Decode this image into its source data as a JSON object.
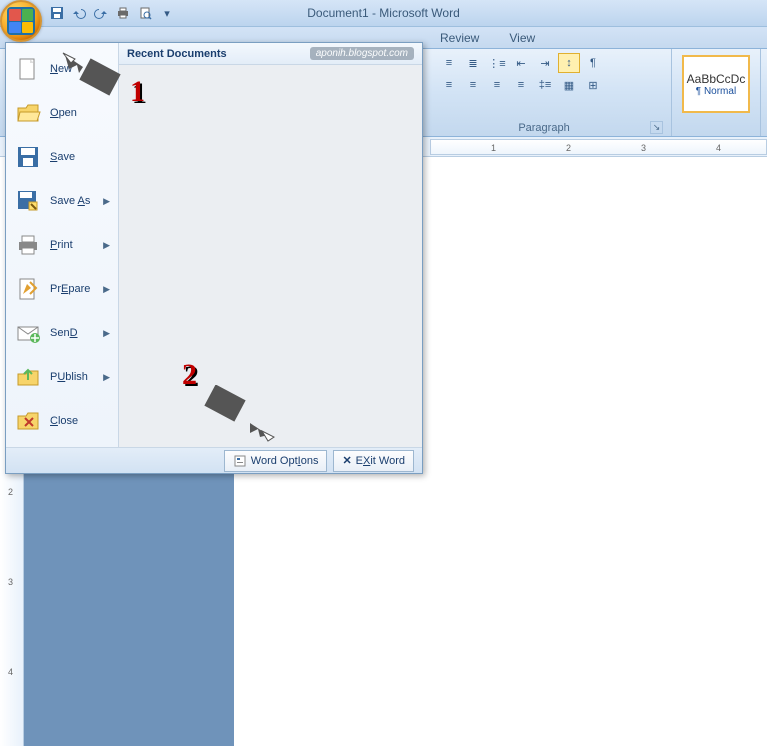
{
  "title": "Document1 - Microsoft Word",
  "qat_icons": [
    "save-icon",
    "undo-icon",
    "redo-icon",
    "quick-print-icon",
    "print-preview-icon",
    "customize-qat-icon"
  ],
  "tabs": {
    "review": "Review",
    "view": "View"
  },
  "ribbon": {
    "paragraph_label": "Paragraph",
    "styles_sample": "AaBbCcDc",
    "styles_name": "¶ Normal"
  },
  "ruler": {
    "nums": [
      "1",
      "2",
      "3",
      "4"
    ]
  },
  "v_ruler": {
    "nums": [
      "2",
      "3",
      "4"
    ]
  },
  "menu": {
    "recent_hdr": "Recent Documents",
    "watermark": "aponih.blogspot.com",
    "items": [
      {
        "label": "New",
        "acc": "N",
        "arrow": false,
        "icon": "new-doc-icon"
      },
      {
        "label": "Open",
        "acc": "O",
        "arrow": false,
        "icon": "open-folder-icon"
      },
      {
        "label": "Save",
        "acc": "S",
        "arrow": false,
        "icon": "save-disk-icon"
      },
      {
        "label": "Save As",
        "acc": "A",
        "arrow": true,
        "icon": "save-as-icon"
      },
      {
        "label": "Print",
        "acc": "P",
        "arrow": true,
        "icon": "print-icon"
      },
      {
        "label": "Prepare",
        "acc": "E",
        "arrow": true,
        "icon": "prepare-icon"
      },
      {
        "label": "Send",
        "acc": "D",
        "arrow": true,
        "icon": "send-mail-icon"
      },
      {
        "label": "Publish",
        "acc": "U",
        "arrow": true,
        "icon": "publish-icon"
      },
      {
        "label": "Close",
        "acc": "C",
        "arrow": false,
        "icon": "close-doc-icon"
      }
    ],
    "footer": {
      "options_label": "Word Options",
      "options_acc": "I",
      "exit_label": "Exit Word",
      "exit_acc": "X"
    }
  },
  "annotations": {
    "one": "1",
    "two": "2"
  }
}
